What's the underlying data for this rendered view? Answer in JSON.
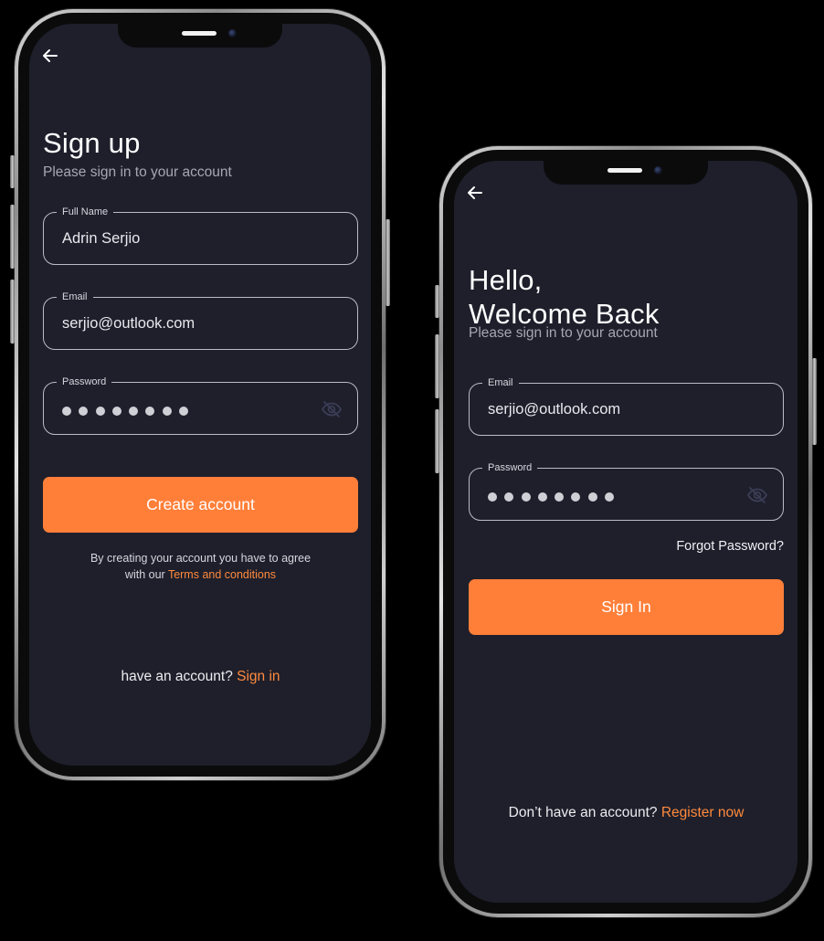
{
  "signup": {
    "title": "Sign up",
    "subtitle": "Please sign in to your account",
    "full_name": {
      "label": "Full Name",
      "value": "Adrin Serjio"
    },
    "email": {
      "label": "Email",
      "value": "serjio@outlook.com"
    },
    "password": {
      "label": "Password",
      "masked_length": 8
    },
    "create_button": "Create account",
    "terms_line1": "By creating your account you have to agree",
    "terms_prefix": "with our ",
    "terms_link": "Terms and conditions",
    "footer_text": "have an account? ",
    "footer_link": "Sign in"
  },
  "signin": {
    "title_line1": "Hello,",
    "title_line2": "Welcome Back",
    "subtitle": "Please sign in to your account",
    "email": {
      "label": "Email",
      "value": "serjio@outlook.com"
    },
    "password": {
      "label": "Password",
      "masked_length": 8
    },
    "forgot": "Forgot Password?",
    "signin_button": "Sign In",
    "footer_text": "Don’t have an account? ",
    "footer_link": "Register now"
  },
  "icons": {
    "back": "arrow-left-icon",
    "eye": "eye-off-icon"
  },
  "colors": {
    "screen_bg": "#1e1f2b",
    "accent": "#ff7f39",
    "field_border": "#b9bbc6",
    "muted_text": "#a5a7b3"
  }
}
